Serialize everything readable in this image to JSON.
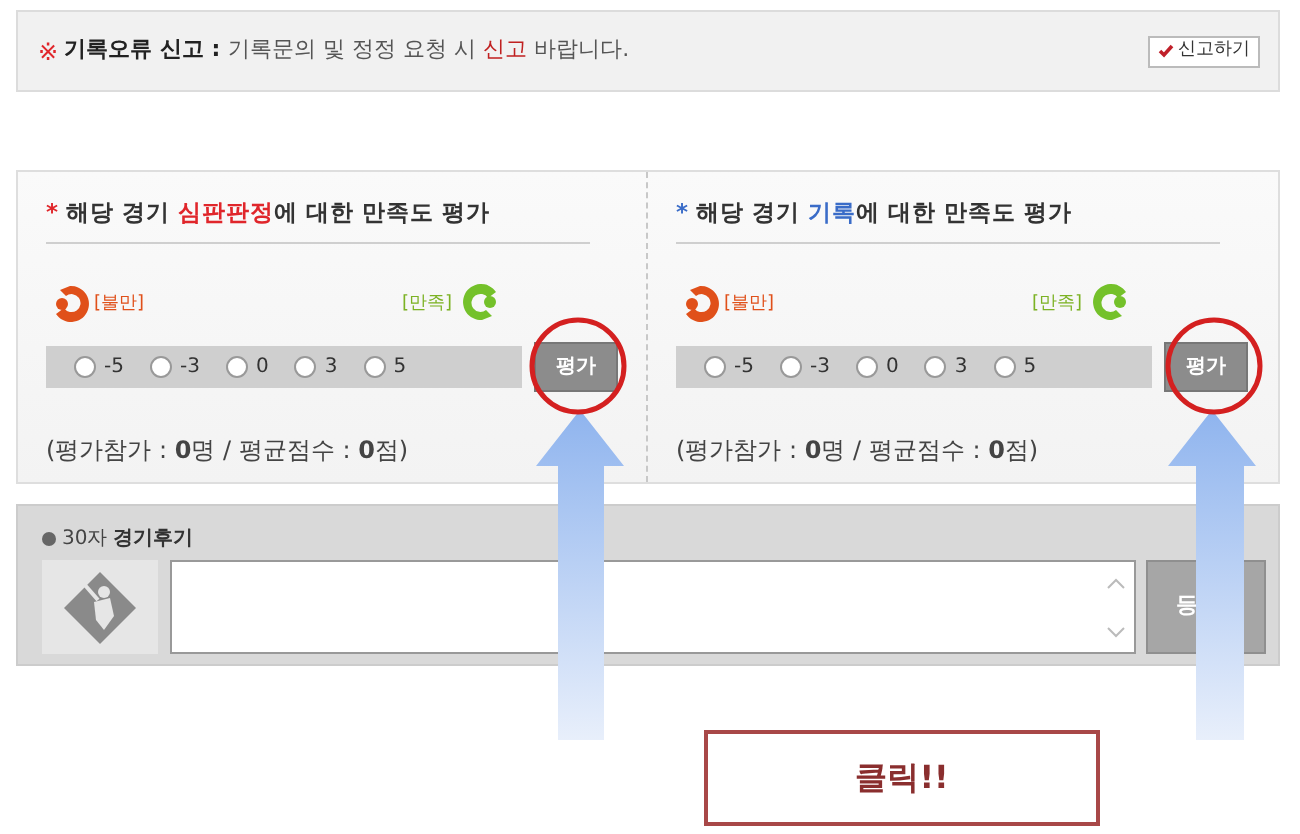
{
  "report": {
    "mark": "※",
    "label": "기록오류 신고 :",
    "message_before": "기록문의 및 정정 요청 시",
    "message_highlight": "신고",
    "message_after": "바랍니다.",
    "button": "신고하기"
  },
  "panels": [
    {
      "bullet": "*",
      "color": "#e0262b",
      "title_before": "해당 경기",
      "title_highlight": "심판판정",
      "title_after": "에 대한 만족도 평가",
      "bad_label": "[불만]",
      "good_label": "[만족]",
      "options": [
        {
          "label": "-5",
          "selected": false
        },
        {
          "label": "-3",
          "selected": false
        },
        {
          "label": "0",
          "selected": false
        },
        {
          "label": "3",
          "selected": false
        },
        {
          "label": "5",
          "selected": false
        }
      ],
      "button": "평가",
      "stats": "(평가참가 : **0**명 / 평균점수 : **0**점)"
    },
    {
      "bullet": "*",
      "color": "#3a6cc8",
      "title_before": "해당 경기",
      "title_highlight": "기록",
      "title_after": "에 대한 만족도 평가",
      "bad_label": "[불만]",
      "good_label": "[만족]",
      "options": [
        {
          "label": "-5",
          "selected": false
        },
        {
          "label": "-3",
          "selected": false
        },
        {
          "label": "0",
          "selected": false
        },
        {
          "label": "3",
          "selected": false
        },
        {
          "label": "5",
          "selected": false
        }
      ],
      "button": "평가",
      "stats": "(평가참가 : **0**명 / 평균점수 : **0**점)"
    }
  ],
  "review": {
    "count_label": "30자",
    "title": "경기후기",
    "button": "등"
  },
  "callout": "클릭!!"
}
